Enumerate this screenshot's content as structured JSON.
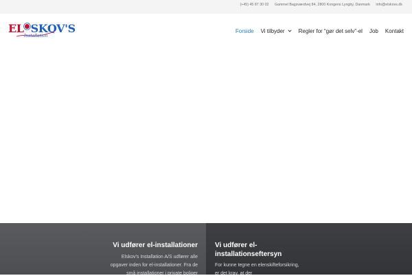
{
  "topbar": {
    "phone": "(+45) 45 87 30 02",
    "address": "Gammel Bagsværdvej 84, 2800 Kongens Lyngby, Danmark",
    "email": "info@elskovs.dk"
  },
  "logo": {
    "text_part1": "EL",
    "text_part2": "SKOV'S",
    "tagline": "Installation",
    "colors": {
      "red": "#c8102e",
      "blue": "#1f5fbf"
    }
  },
  "nav": {
    "items": [
      {
        "label": "Forside",
        "active": true
      },
      {
        "label": "Vi tilbyder",
        "has_dropdown": true,
        "icon": "chevron-down-icon"
      },
      {
        "label": "Regler for “gør det selv”-el"
      },
      {
        "label": "Job"
      },
      {
        "label": "Kontakt"
      }
    ],
    "active_color": "#2f7fc1"
  },
  "features": {
    "left": {
      "title": "Vi udfører el-installationer",
      "body": "Elskov’s Installation A/S udfører alle opgaver inden for el-installationer. Fra de små installationer i private boliger"
    },
    "right": {
      "title": "Vi udfører el-installationseftersyn",
      "body": "For kunne tegne en elenskifteforsikring, er det krav, at der"
    }
  }
}
